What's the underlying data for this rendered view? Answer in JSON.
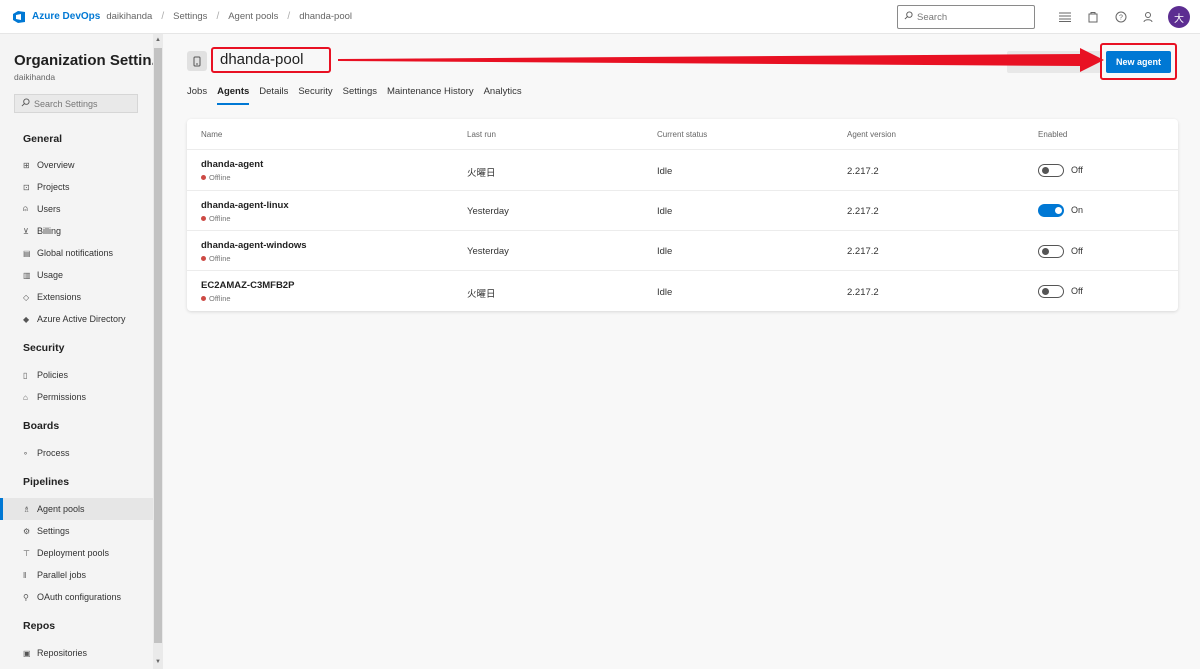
{
  "topbar": {
    "brand": "Azure DevOps",
    "org": "daikihanda",
    "breadcrumbs": [
      "Settings",
      "Agent pools",
      "dhanda-pool"
    ],
    "search_placeholder": "Search",
    "avatar_initial": "大"
  },
  "sidebar": {
    "title": "Organization Settin...",
    "subtitle": "daikihanda",
    "search_placeholder": "Search Settings",
    "sections": {
      "general": "General",
      "security": "Security",
      "boards": "Boards",
      "pipelines": "Pipelines",
      "repos": "Repos"
    },
    "items": {
      "overview": "Overview",
      "projects": "Projects",
      "users": "Users",
      "billing": "Billing",
      "global_notifications": "Global notifications",
      "usage": "Usage",
      "extensions": "Extensions",
      "aad": "Azure Active Directory",
      "policies": "Policies",
      "permissions": "Permissions",
      "process": "Process",
      "agent_pools": "Agent pools",
      "settings": "Settings",
      "deployment_pools": "Deployment pools",
      "parallel_jobs": "Parallel jobs",
      "oauth": "OAuth configurations",
      "repositories": "Repositories"
    },
    "active_item": "Agent pools"
  },
  "main": {
    "pool_name": "dhanda-pool",
    "new_agent_label": "New agent",
    "tabs": [
      "Jobs",
      "Agents",
      "Details",
      "Security",
      "Settings",
      "Maintenance History",
      "Analytics"
    ],
    "active_tab": "Agents",
    "table": {
      "headers": {
        "name": "Name",
        "last_run": "Last run",
        "status": "Current status",
        "version": "Agent version",
        "enabled": "Enabled"
      },
      "rows": [
        {
          "name": "dhanda-agent",
          "state": "Offline",
          "last_run": "火曜日",
          "status": "Idle",
          "version": "2.217.2",
          "enabled": false,
          "enabled_label": "Off"
        },
        {
          "name": "dhanda-agent-linux",
          "state": "Offline",
          "last_run": "Yesterday",
          "status": "Idle",
          "version": "2.217.2",
          "enabled": true,
          "enabled_label": "On"
        },
        {
          "name": "dhanda-agent-windows",
          "state": "Offline",
          "last_run": "Yesterday",
          "status": "Idle",
          "version": "2.217.2",
          "enabled": false,
          "enabled_label": "Off"
        },
        {
          "name": "EC2AMAZ-C3MFB2P",
          "state": "Offline",
          "last_run": "火曜日",
          "status": "Idle",
          "version": "2.217.2",
          "enabled": false,
          "enabled_label": "Off"
        }
      ]
    }
  },
  "colors": {
    "accent": "#0078d4",
    "annotation": "#e81123",
    "offline_dot": "#cd4a45",
    "avatar": "#5c2d91"
  }
}
